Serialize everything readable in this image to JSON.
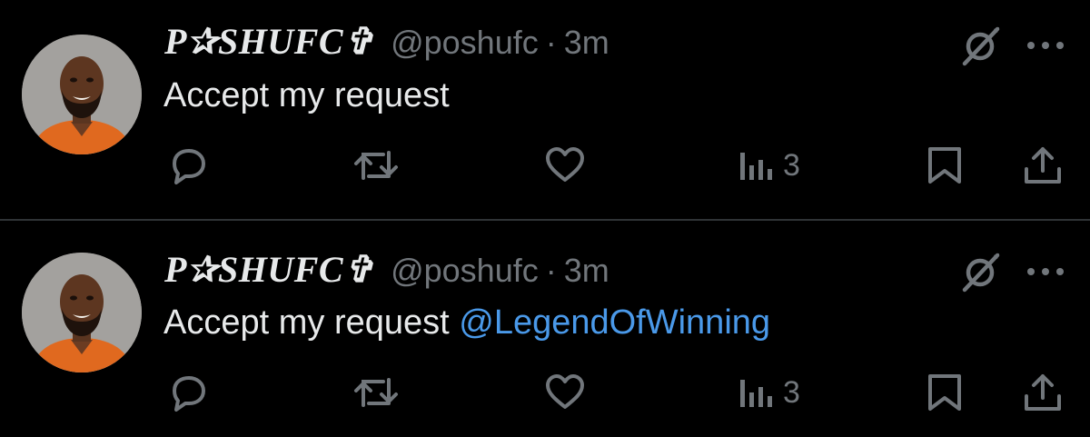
{
  "tweets": [
    {
      "display_name": "P✰SHUFC✞",
      "handle": "@poshufc",
      "separator": "·",
      "time": "3m",
      "text": "Accept my request",
      "mention": "",
      "views": "3"
    },
    {
      "display_name": "P✰SHUFC✞",
      "handle": "@poshufc",
      "separator": "·",
      "time": "3m",
      "text": "Accept my request ",
      "mention": "@LegendOfWinning",
      "views": "3"
    }
  ],
  "icons": {
    "reply": "reply-icon",
    "repost": "repost-icon",
    "like": "heart-icon",
    "views": "views-icon",
    "bookmark": "bookmark-icon",
    "share": "share-icon",
    "grok": "grok-icon",
    "more": "more-icon"
  },
  "colors": {
    "background": "#000000",
    "text": "#e7e9ea",
    "secondary": "#71767b",
    "mention": "#4a99e9",
    "divider": "#2f3336"
  }
}
